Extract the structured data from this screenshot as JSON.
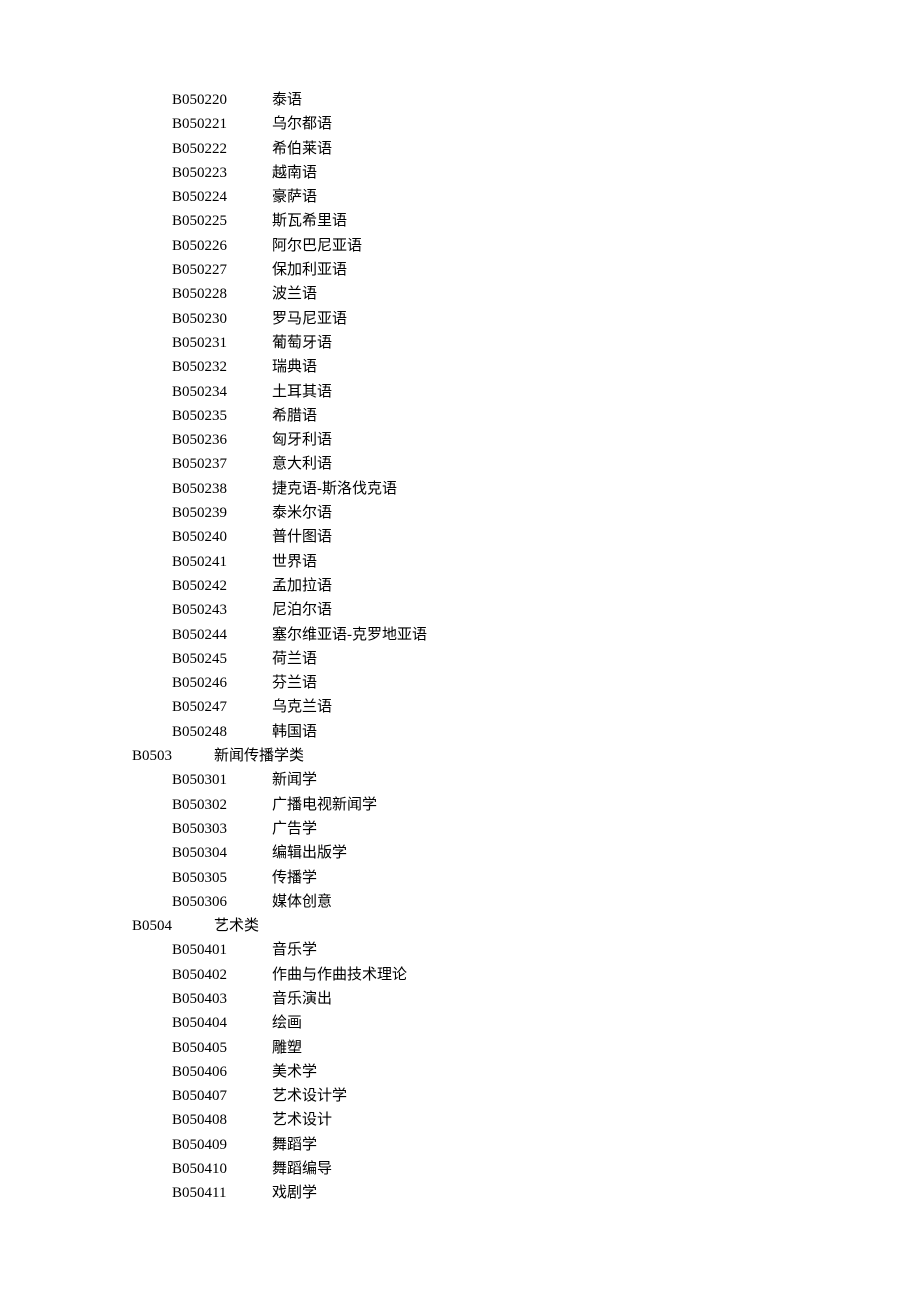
{
  "rows": [
    {
      "type": "sub",
      "code": "B050220",
      "name": "泰语"
    },
    {
      "type": "sub",
      "code": "B050221",
      "name": "乌尔都语"
    },
    {
      "type": "sub",
      "code": "B050222",
      "name": "希伯莱语"
    },
    {
      "type": "sub",
      "code": "B050223",
      "name": "越南语"
    },
    {
      "type": "sub",
      "code": "B050224",
      "name": "豪萨语"
    },
    {
      "type": "sub",
      "code": "B050225",
      "name": "斯瓦希里语"
    },
    {
      "type": "sub",
      "code": "B050226",
      "name": "阿尔巴尼亚语"
    },
    {
      "type": "sub",
      "code": "B050227",
      "name": "保加利亚语"
    },
    {
      "type": "sub",
      "code": "B050228",
      "name": "波兰语"
    },
    {
      "type": "sub",
      "code": "B050230",
      "name": "罗马尼亚语"
    },
    {
      "type": "sub",
      "code": "B050231",
      "name": "葡萄牙语"
    },
    {
      "type": "sub",
      "code": "B050232",
      "name": "瑞典语"
    },
    {
      "type": "sub",
      "code": "B050234",
      "name": "土耳其语"
    },
    {
      "type": "sub",
      "code": "B050235",
      "name": "希腊语"
    },
    {
      "type": "sub",
      "code": "B050236",
      "name": "匈牙利语"
    },
    {
      "type": "sub",
      "code": "B050237",
      "name": "意大利语"
    },
    {
      "type": "sub",
      "code": "B050238",
      "name": "捷克语-斯洛伐克语"
    },
    {
      "type": "sub",
      "code": "B050239",
      "name": "泰米尔语"
    },
    {
      "type": "sub",
      "code": "B050240",
      "name": "普什图语"
    },
    {
      "type": "sub",
      "code": "B050241",
      "name": "世界语"
    },
    {
      "type": "sub",
      "code": "B050242",
      "name": "孟加拉语"
    },
    {
      "type": "sub",
      "code": "B050243",
      "name": "尼泊尔语"
    },
    {
      "type": "sub",
      "code": "B050244",
      "name": "塞尔维亚语-克罗地亚语"
    },
    {
      "type": "sub",
      "code": "B050245",
      "name": "荷兰语"
    },
    {
      "type": "sub",
      "code": "B050246",
      "name": "芬兰语"
    },
    {
      "type": "sub",
      "code": "B050247",
      "name": "乌克兰语"
    },
    {
      "type": "sub",
      "code": "B050248",
      "name": "韩国语"
    },
    {
      "type": "cat",
      "code": "B0503",
      "name": "新闻传播学类"
    },
    {
      "type": "sub",
      "code": "B050301",
      "name": "新闻学"
    },
    {
      "type": "sub",
      "code": "B050302",
      "name": "广播电视新闻学"
    },
    {
      "type": "sub",
      "code": "B050303",
      "name": "广告学"
    },
    {
      "type": "sub",
      "code": "B050304",
      "name": "编辑出版学"
    },
    {
      "type": "sub",
      "code": "B050305",
      "name": "传播学"
    },
    {
      "type": "sub",
      "code": "B050306",
      "name": "媒体创意"
    },
    {
      "type": "cat",
      "code": "B0504",
      "name": "艺术类"
    },
    {
      "type": "sub",
      "code": "B050401",
      "name": "音乐学"
    },
    {
      "type": "sub",
      "code": "B050402",
      "name": "作曲与作曲技术理论"
    },
    {
      "type": "sub",
      "code": "B050403",
      "name": "音乐演出"
    },
    {
      "type": "sub",
      "code": "B050404",
      "name": "绘画"
    },
    {
      "type": "sub",
      "code": "B050405",
      "name": "雕塑"
    },
    {
      "type": "sub",
      "code": "B050406",
      "name": "美术学"
    },
    {
      "type": "sub",
      "code": "B050407",
      "name": "艺术设计学"
    },
    {
      "type": "sub",
      "code": "B050408",
      "name": "艺术设计"
    },
    {
      "type": "sub",
      "code": "B050409",
      "name": "舞蹈学"
    },
    {
      "type": "sub",
      "code": "B050410",
      "name": "舞蹈编导"
    },
    {
      "type": "sub",
      "code": "B050411",
      "name": "戏剧学"
    }
  ]
}
